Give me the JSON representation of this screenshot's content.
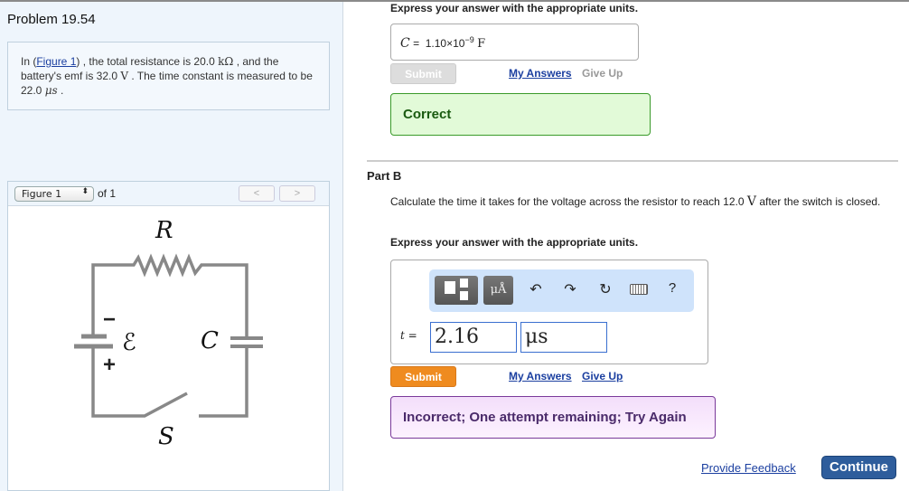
{
  "problem": {
    "title": "Problem 19.54",
    "text_pre": "In (",
    "figure_link": "Figure 1",
    "text_1": ") , the total resistance is 20.0 ",
    "unit_res": "kΩ",
    "text_2": " , and the battery's emf is 32.0 ",
    "unit_v": "V",
    "text_3": " . The time constant is measured to be 22.0 ",
    "unit_t": "μs",
    "text_4": " ."
  },
  "figure": {
    "selector": "Figure 1",
    "of": "of 1",
    "prev": "<",
    "next": ">",
    "labels": {
      "R": "R",
      "emf": "ℰ",
      "C": "C",
      "S": "S",
      "minus": "−",
      "plus": "+"
    }
  },
  "partA": {
    "express": "Express your answer with the appropriate units.",
    "var": "C",
    "eq": "=",
    "value": "1.10×10",
    "exp": "−9",
    "unit": "F",
    "submit": "Submit",
    "my_answers": "My Answers",
    "give_up": "Give Up",
    "feedback": "Correct"
  },
  "partB": {
    "heading": "Part B",
    "question_pre": "Calculate the time it takes for the voltage across the resistor to reach 12.0 ",
    "question_unit": "V",
    "question_post": " after the switch is closed.",
    "express": "Express your answer with the appropriate units.",
    "toolbar": {
      "units": "μÅ",
      "help": "?"
    },
    "var": "t =",
    "value": "2.16",
    "unit": "μs",
    "submit": "Submit",
    "my_answers": "My Answers",
    "give_up": "Give Up",
    "feedback": "Incorrect; One attempt remaining; Try Again"
  },
  "footer": {
    "provide_feedback": "Provide Feedback",
    "continue": "Continue"
  }
}
